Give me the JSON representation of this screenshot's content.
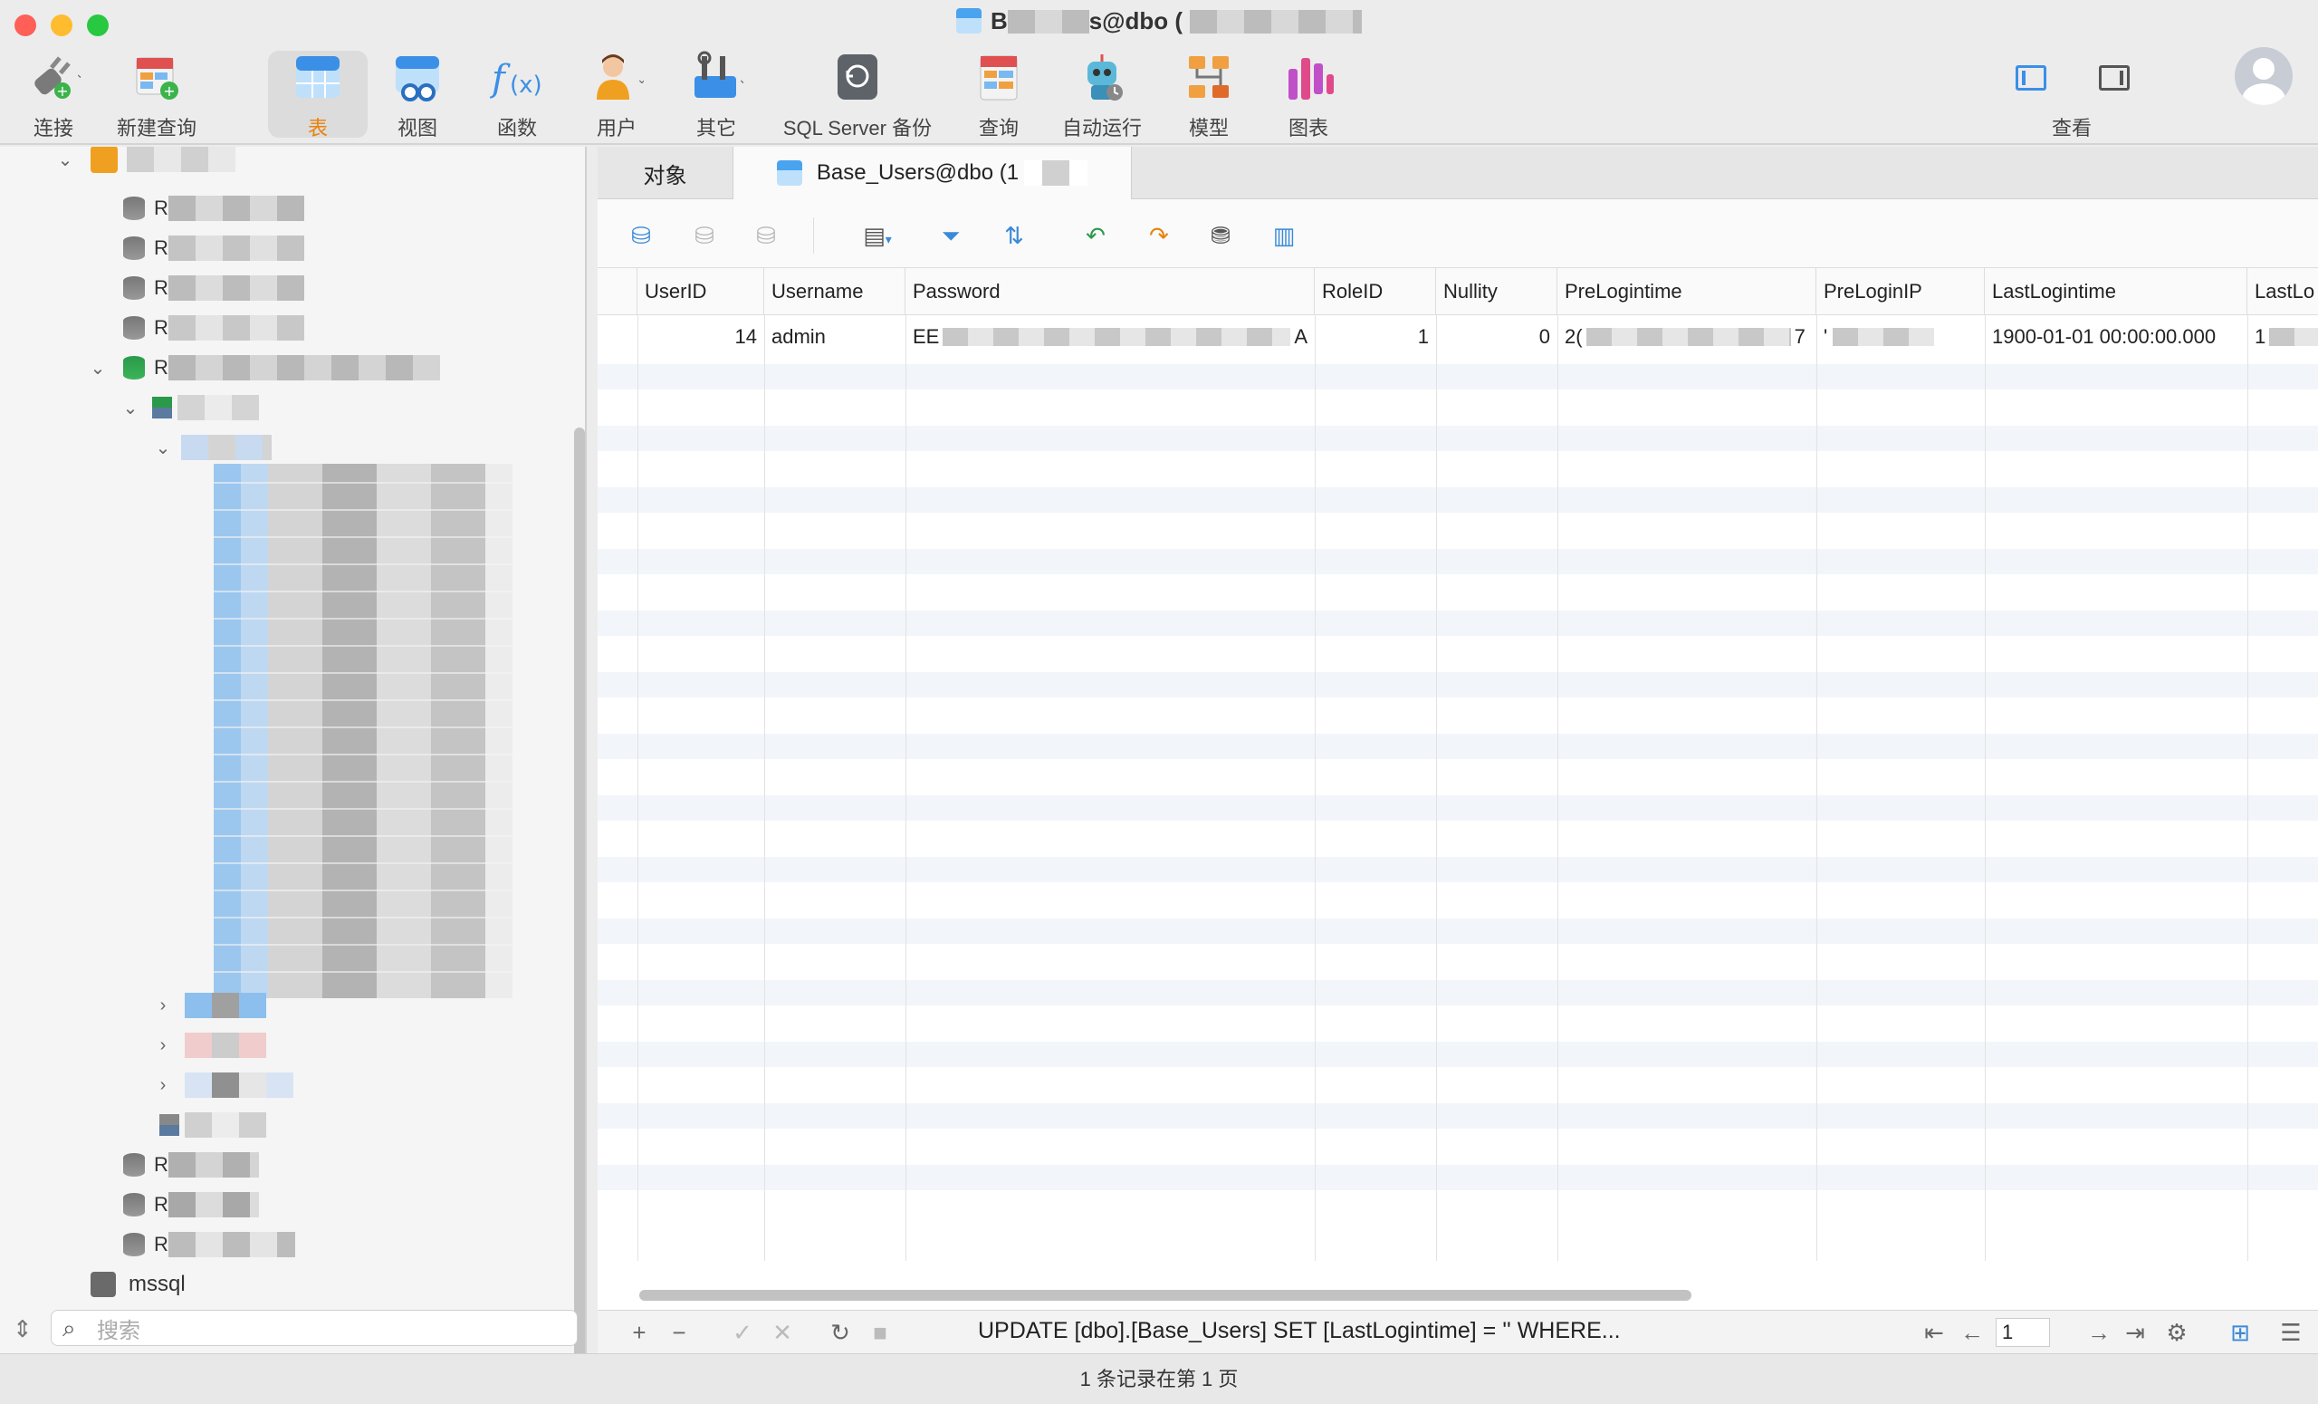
{
  "window": {
    "title_prefix": "B",
    "title_mid": "s@dbo (",
    "title_suffix": ""
  },
  "toolbar": {
    "items": [
      {
        "label": "连接",
        "icon": "plug-icon"
      },
      {
        "label": "新建查询",
        "icon": "new-query-icon"
      },
      {
        "label": "表",
        "icon": "table-icon"
      },
      {
        "label": "视图",
        "icon": "view-icon"
      },
      {
        "label": "函数",
        "icon": "function-icon"
      },
      {
        "label": "用户",
        "icon": "user-icon"
      },
      {
        "label": "其它",
        "icon": "tools-icon"
      },
      {
        "label": "SQL Server 备份",
        "icon": "backup-icon"
      },
      {
        "label": "查询",
        "icon": "query-icon"
      },
      {
        "label": "自动运行",
        "icon": "robot-icon"
      },
      {
        "label": "模型",
        "icon": "model-icon"
      },
      {
        "label": "图表",
        "icon": "chart-icon"
      }
    ],
    "view_label": "查看"
  },
  "sidebar": {
    "db_prefix": "R",
    "bottom_connection": "mssql",
    "search_placeholder": "搜索"
  },
  "tabs": {
    "objects": "对象",
    "table": "Base_Users@dbo (1"
  },
  "grid": {
    "columns": [
      "UserID",
      "Username",
      "Password",
      "RoleID",
      "Nullity",
      "PreLogintime",
      "PreLoginIP",
      "LastLogintime",
      "LastLo"
    ],
    "row": {
      "UserID": "14",
      "Username": "admin",
      "Password_start": "EE",
      "Password_end": "A",
      "RoleID": "1",
      "Nullity": "0",
      "PreLogintime_start": "2(",
      "PreLogintime_end": "7",
      "PreLoginIP_start": "'",
      "LastLogintime": "1900-01-01 00:00:00.000",
      "LastLo_start": "1"
    }
  },
  "bottombar": {
    "sql": "UPDATE [dbo].[Base_Users] SET [LastLogintime] = '' WHERE...",
    "page": "1"
  },
  "status": {
    "text": "1 条记录在第 1 页"
  },
  "colors": {
    "accent": "#e8820c",
    "blue": "#3a8ad8",
    "close": "#fe5f57",
    "minimize": "#febc2e",
    "maximize": "#28c840"
  }
}
